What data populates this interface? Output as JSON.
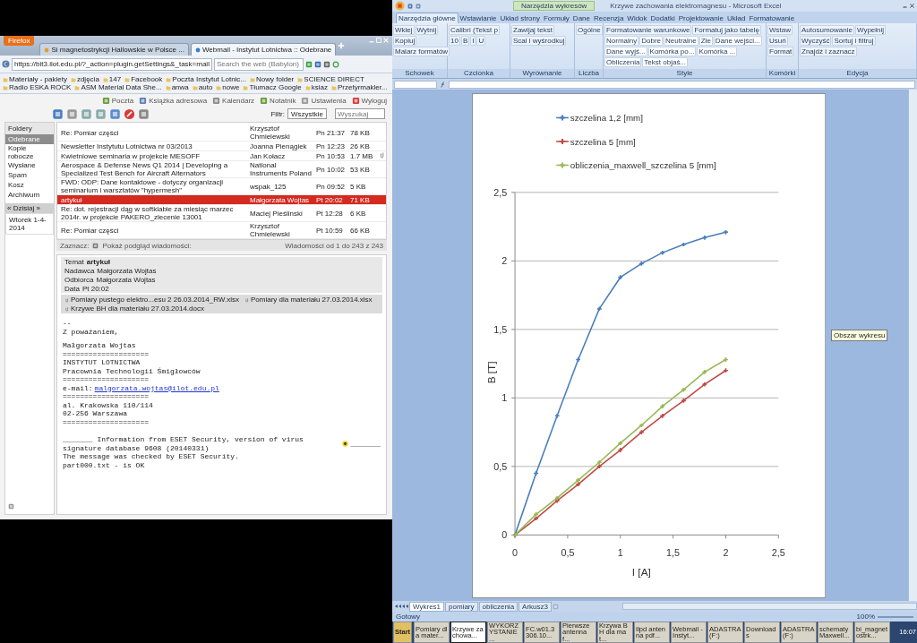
{
  "browser": {
    "app_menu": "Firefox",
    "tabs": [
      {
        "label": "Si magnetostrykcji Hallowskie w Polsce ...",
        "selected": false
      },
      {
        "label": "Webmail - Instytut Lotnictwa :: Odebrane",
        "selected": true
      }
    ],
    "url": "https://bit3.ilot.edu.pl/?_action=plugin.getSettings&_task=mail",
    "search": {
      "placeholder": "Search the web (Babylon)"
    },
    "bookmarks": [
      "Materiały - pakiety",
      "zdjęcia",
      "147",
      "Facebook",
      "Poczta Instytut Lotnic...",
      "Nowy folder",
      "SCIENCE DIRECT",
      "Radio ESKA ROCK",
      "ASM Material Data She...",
      "anwa",
      "auto",
      "nowe",
      "Tłumacz Google",
      "ksiaz",
      "Przetyrmakler..."
    ],
    "top_nav": [
      "Poczta",
      "Książka adresowa",
      "Kalendarz",
      "Notatnik",
      "Ustawienia",
      "Wyloguj"
    ],
    "filter": {
      "label": "Filtr:",
      "value": "Wszystkie"
    },
    "mail_search": {
      "placeholder": "Wyszukaj"
    },
    "folders_title": "Foldery",
    "folders": [
      {
        "label": "Odebrane",
        "selected": true
      },
      {
        "label": "Kopie robocze",
        "selected": false
      },
      {
        "label": "Wysłane",
        "selected": false
      },
      {
        "label": "Spam",
        "selected": false
      },
      {
        "label": "Kosz",
        "selected": false
      },
      {
        "label": "Archiwum",
        "selected": false
      }
    ],
    "calendar": {
      "header": "« Dzisiaj »",
      "date": "Wtorek 1-4-2014"
    },
    "messages": [
      {
        "subject": "Re: Pomiar części",
        "from": "Krzysztof Chmielewski",
        "date": "Pn 21:37",
        "size": "78 KB",
        "attachment": false,
        "selected": false
      },
      {
        "subject": "Newsletter Instytutu Lotnictwa nr 03/2013",
        "from": "Joanna Pienągiek",
        "date": "Pn 12:23",
        "size": "26 KB",
        "attachment": false,
        "selected": false
      },
      {
        "subject": "Kwietniowe seminaria w projekcie MESOFF",
        "from": "Jan Kołacz",
        "date": "Pn 10:53",
        "size": "1.7 MB",
        "attachment": true,
        "selected": false
      },
      {
        "subject": "Aerospace & Defense News Q1 2014 | Developing a Specialized Test Bench for Aircraft Alternators",
        "from": "National Instruments Poland",
        "date": "Pn 10:02",
        "size": "53 KB",
        "attachment": false,
        "selected": false
      },
      {
        "subject": "FWD: ODP: Dane kontaktowe - dotyczy organizacji seminarium i warsztatów \"hypermesh\"",
        "from": "wspak_125",
        "date": "Pn 09:52",
        "size": "5 KB",
        "attachment": false,
        "selected": false
      },
      {
        "subject": "artykuł",
        "from": "Małgorzata Wojtas",
        "date": "Pt 20:02",
        "size": "71 KB",
        "attachment": false,
        "selected": true
      },
      {
        "subject": "Re: dot. rejestracji dąg w softklabie za miesiąc marzec 2014r. w projekcie PAKERO_zlecenie 13001",
        "from": "Maciej Pieślinski",
        "date": "Pt 12:28",
        "size": "6 KB",
        "attachment": false,
        "selected": false
      },
      {
        "subject": "Re: Pomiar części",
        "from": "Krzysztof Chmielewski",
        "date": "Pt 10:59",
        "size": "66 KB",
        "attachment": false,
        "selected": false
      }
    ],
    "list_footer": {
      "select_label": "Zaznacz:",
      "preview_label": "Pokaż podgląd wiadomości:",
      "count": "Wiadomości od 1 do 243 z 243"
    },
    "preview": {
      "subject_label": "Temat",
      "subject": "artykuł",
      "fields": [
        {
          "label": "Nadawca",
          "value": "Małgorzata Wojtas"
        },
        {
          "label": "Odbiorca",
          "value": "Małgorzata Wojtas"
        },
        {
          "label": "Data",
          "value": "Pt 20:02"
        }
      ],
      "attachments": [
        "Pomiary pustego elektro...esu 2 26.03.2014_RW.xlsx",
        "Pomiary dla materiału 27.03.2014.xlsx",
        "Krzywe BH dla materiału 27.03.2014.docx"
      ],
      "body": [
        [
          "--",
          "Z poważaniem,"
        ],
        [
          "Małgorzata Wojtas",
          "====================",
          "INSTYTUT LOTNICTWA",
          "Pracownia Technologii Śmigłowców",
          "====================",
          {
            "kind": "link",
            "label": "e-mail:",
            "link": "malgorzata.wojtas@ilot.edu.pl"
          },
          "====================",
          "al. Krakowska 110/114",
          "02-256 Warszawa",
          "===================="
        ],
        [
          {
            "kind": "notice",
            "text": "_______ Information from ESET Security, version of virus signature database 9608 (20140331)",
            "tail": "_______"
          },
          "The message was checked by ESET Security.",
          "part000.txt - is OK"
        ]
      ]
    }
  },
  "excel": {
    "context_tab": "Narzędzia wykresów",
    "title": "Krzywe zachowania elektromagnesu - Microsoft Excel",
    "ribbon_tabs": [
      {
        "label": "Narzędzia główne",
        "selected": true
      },
      {
        "label": "Wstawianie",
        "selected": false
      },
      {
        "label": "Układ strony",
        "selected": false
      },
      {
        "label": "Formuły",
        "selected": false
      },
      {
        "label": "Dane",
        "selected": false
      },
      {
        "label": "Recenzja",
        "selected": false
      },
      {
        "label": "Widok",
        "selected": false
      },
      {
        "label": "Dodatki",
        "selected": false
      },
      {
        "label": "Projektowanie",
        "selected": false
      },
      {
        "label": "Układ",
        "selected": false
      },
      {
        "label": "Formatowanie",
        "selected": false
      }
    ],
    "ribbon_groups": [
      {
        "label": "Schowek",
        "items": [
          "Wklej",
          "Wytnij",
          "Kopiuj",
          "Malarz formatów"
        ]
      },
      {
        "label": "Czcionka",
        "items": [
          "Calibri (Tekst p",
          "10",
          "B",
          "I",
          "U"
        ]
      },
      {
        "label": "Wyrównanie",
        "items": [
          "Zawijaj tekst",
          "Scal i wyśrodkuj"
        ]
      },
      {
        "label": "Liczba",
        "items": [
          "Ogólne"
        ]
      },
      {
        "label": "Style",
        "items": [
          "Formatowanie warunkowe",
          "Formatuj jako tabelę",
          "Normalny",
          "Dobre",
          "Neutralne",
          "Złe",
          "Dane wejści...",
          "Dane wyjś...",
          "Komórka po...",
          "Komórka ...",
          "Obliczenia",
          "Tekst objaś..."
        ]
      },
      {
        "label": "Komórki",
        "items": [
          "Wstaw",
          "Usuń",
          "Format"
        ]
      },
      {
        "label": "Edycja",
        "items": [
          "Autosumowanie",
          "Wypełnij",
          "Wyczyść",
          "Sortuj i filtruj",
          "Znajdź i zaznacz"
        ]
      }
    ],
    "chart": {
      "tooltip": "Obszar wykresu",
      "chart_data": {
        "type": "line",
        "xlabel": "I [A]",
        "ylabel": "B [T]",
        "grid": true,
        "legend": true,
        "x": [
          0,
          0.2,
          0.4,
          0.6,
          0.8,
          1,
          1.2,
          1.4,
          1.6,
          1.8,
          2
        ],
        "series": [
          {
            "name": "szczelina 1,2 [mm]",
            "color": "#4a7ebb",
            "values": [
              0,
              0.45,
              0.87,
              1.28,
              1.65,
              1.88,
              1.98,
              2.06,
              2.12,
              2.17,
              2.21
            ]
          },
          {
            "name": "szczelina 5 [mm]",
            "color": "#be4b48",
            "values": [
              0,
              0.12,
              0.25,
              0.37,
              0.5,
              0.62,
              0.75,
              0.87,
              0.98,
              1.1,
              1.2
            ]
          },
          {
            "name": "obliczenia_maxwell_szczelina 5 [mm]",
            "color": "#98b954",
            "values": [
              0,
              0.15,
              0.27,
              0.4,
              0.53,
              0.67,
              0.8,
              0.94,
              1.06,
              1.19,
              1.28
            ]
          }
        ],
        "xlim": [
          0,
          2.5
        ],
        "ylim": [
          0,
          2.5
        ],
        "xticks": [
          {
            "value": 0,
            "label": "0"
          },
          {
            "value": 0.5,
            "label": "0,5"
          },
          {
            "value": 1,
            "label": "1"
          },
          {
            "value": 1.5,
            "label": "1,5"
          },
          {
            "value": 2,
            "label": "2"
          },
          {
            "value": 2.5,
            "label": "2,5"
          }
        ],
        "yticks": [
          {
            "value": 0,
            "label": "0"
          },
          {
            "value": 0.5,
            "label": "0,5"
          },
          {
            "value": 1,
            "label": "1"
          },
          {
            "value": 1.5,
            "label": "1,5"
          },
          {
            "value": 2,
            "label": "2"
          },
          {
            "value": 2.5,
            "label": "2,5"
          }
        ]
      }
    },
    "sheet_tabs": [
      {
        "label": "Wykres1",
        "selected": true
      },
      {
        "label": "pomiary",
        "selected": false
      },
      {
        "label": "obliczenia",
        "selected": false
      },
      {
        "label": "Arkusz3",
        "selected": false
      }
    ],
    "status": "Gotowy",
    "zoom": "100%"
  },
  "taskbar": {
    "start": "Start",
    "items": [
      {
        "label": "Pomiary dla mater...",
        "selected": false
      },
      {
        "label": "Krzywe zachowa...",
        "selected": true
      },
      {
        "label": "WYKORZYSTANIE ...",
        "selected": false
      },
      {
        "label": "FC.w01.3306.10...",
        "selected": false
      },
      {
        "label": "Pierwsze antenna f...",
        "selected": false
      },
      {
        "label": "Krzywa BH dla mat...",
        "selected": false
      },
      {
        "label": "Ilpd antenna pdf...",
        "selected": false
      },
      {
        "label": "Webmail - Instyt...",
        "selected": false
      },
      {
        "label": "ADASTRA (F:)",
        "selected": false
      },
      {
        "label": "Downloads",
        "selected": false
      },
      {
        "label": "ADASTRA (F:)",
        "selected": false
      },
      {
        "label": "schematy Maxwell...",
        "selected": false
      },
      {
        "label": "bi_magnetostrk...",
        "selected": false
      }
    ],
    "clock": "16:07"
  }
}
